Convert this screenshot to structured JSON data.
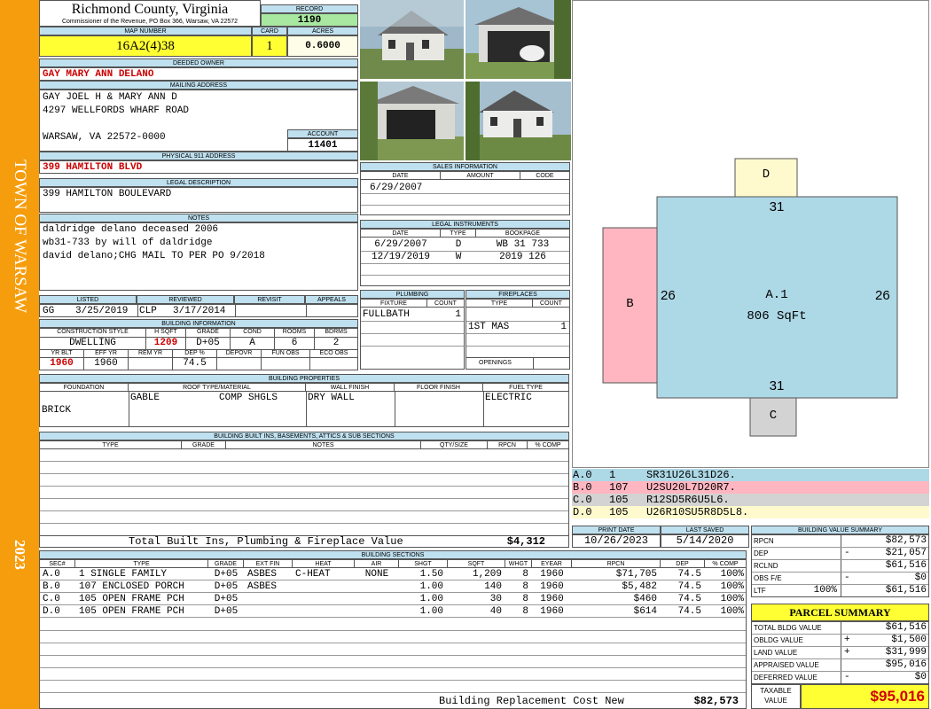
{
  "side": {
    "town": "TOWN OF WARSAW",
    "year": "2023"
  },
  "header": {
    "county": "Richmond County, Virginia",
    "commissioner": "Commissioner of the Revenue, PO Box 366, Warsaw, VA 22572",
    "record_label": "RECORD",
    "record": "1190",
    "map_label": "MAP NUMBER",
    "map": "16A2(4)38",
    "card_label": "CARD",
    "card": "1",
    "acres_label": "ACRES",
    "acres": "0.6000"
  },
  "owner": {
    "label": "DEEDED OWNER",
    "name": "GAY MARY ANN DELANO"
  },
  "mailing": {
    "label": "MAILING ADDRESS",
    "line1": "GAY JOEL H & MARY ANN D",
    "line2": "4297 WELLFORDS WHARF ROAD",
    "line3": "WARSAW, VA 22572-0000",
    "account_label": "ACCOUNT",
    "account": "11401"
  },
  "physical": {
    "label": "PHYSICAL 911 ADDRESS",
    "value": "399 HAMILTON BLVD"
  },
  "legal": {
    "label": "LEGAL DESCRIPTION",
    "value": "399 HAMILTON BOULEVARD"
  },
  "notes": {
    "label": "NOTES",
    "line1": "daldridge delano deceased 2006",
    "line2": "wb31-733 by will of daldridge",
    "line3": "david delano;CHG MAIL TO PER PO 9/2018"
  },
  "listed": {
    "listed_label": "LISTED",
    "listed_by": "GG",
    "listed_date": "3/25/2019",
    "reviewed_label": "REVIEWED",
    "reviewed_by": "CLP",
    "reviewed_date": "3/17/2014",
    "revisit_label": "REVISIT",
    "appeals_label": "APPEALS"
  },
  "building_info": {
    "label": "BUILDING INFORMATION",
    "h": [
      "CONSTRUCTION STYLE",
      "H SQFT",
      "GRADE",
      "COND",
      "ROOMS",
      "BDRMS"
    ],
    "v": [
      "DWELLING",
      "1209",
      "D+05",
      "A",
      "6",
      "2"
    ],
    "h2": [
      "YR BLT",
      "EFF YR",
      "REM YR",
      "DEP %",
      "DEPOVR",
      "FUN OBS",
      "ECO OBS"
    ],
    "v2": [
      "1960",
      "1960",
      "",
      "74.5",
      "",
      "",
      ""
    ]
  },
  "sales": {
    "label": "SALES INFORMATION",
    "h": [
      "DATE",
      "AMOUNT",
      "CODE"
    ],
    "rows": [
      [
        "6/29/2007",
        "",
        ""
      ]
    ]
  },
  "legal_inst": {
    "label": "LEGAL INSTRUMENTS",
    "h": [
      "DATE",
      "TYPE",
      "BOOKPAGE"
    ],
    "rows": [
      [
        "6/29/2007",
        "D",
        "WB 31 733"
      ],
      [
        "12/19/2019",
        "W",
        "2019 126"
      ]
    ]
  },
  "plumbing": {
    "label": "PLUMBING",
    "h": [
      "FIXTURE",
      "COUNT"
    ],
    "rows": [
      [
        "FULLBATH",
        "1"
      ]
    ]
  },
  "fireplaces": {
    "label": "FIREPLACES",
    "h": [
      "TYPE",
      "COUNT"
    ],
    "rows": [
      [
        "1ST MAS",
        "1"
      ]
    ],
    "openings": "OPENINGS"
  },
  "props": {
    "label": "BUILDING PROPERTIES",
    "h": [
      "FOUNDATION",
      "ROOF TYPE/MATERIAL",
      "WALL FINISH",
      "FLOOR FINISH",
      "FUEL TYPE"
    ],
    "foundation": "BRICK",
    "roof1": "GABLE",
    "roof2": "COMP SHGLS",
    "wall": "DRY WALL",
    "floor": "",
    "fuel": "ELECTRIC"
  },
  "builtins": {
    "label": "BUILDING BUILT INS, BASEMENTS, ATTICS & SUB SECTIONS",
    "h": [
      "TYPE",
      "GRADE",
      "NOTES",
      "QTY/SIZE",
      "RPCN",
      "% COMP"
    ],
    "total_label": "Total Built Ins, Plumbing & Fireplace Value",
    "total": "$4,312"
  },
  "sketch": {
    "main_label": "A.1",
    "main_area": "806 SqFt",
    "top": "31",
    "bottom": "31",
    "left": "26",
    "right": "26",
    "d": "D",
    "b": "B",
    "c": "C"
  },
  "sections_codes": [
    {
      "id": "A.0",
      "code": "1",
      "path": "SR31U26L31D26.",
      "color": "#add8e6"
    },
    {
      "id": "B.0",
      "code": "107",
      "path": "U2SU20L7D20R7.",
      "color": "#ffb6c1"
    },
    {
      "id": "C.0",
      "code": "105",
      "path": "R12SD5R6U5L6.",
      "color": "#d3d3d3"
    },
    {
      "id": "D.0",
      "code": "105",
      "path": "U26R10SU5R8D5L8.",
      "color": "#fffacd"
    }
  ],
  "dates": {
    "print_label": "PRINT DATE",
    "print": "10/26/2023",
    "saved_label": "LAST SAVED",
    "saved": "5/14/2020"
  },
  "bsections": {
    "label": "BUILDING SECTIONS",
    "h": [
      "SEC#",
      "TYPE",
      "GRADE",
      "EXT FIN",
      "HEAT",
      "AIR",
      "SHGT",
      "SQFT",
      "WHGT",
      "EYEAR",
      "RPCN",
      "DEP",
      "% COMP"
    ],
    "rows": [
      [
        "A.0",
        "1 SINGLE FAMILY",
        "D+05",
        "ASBES",
        "C-HEAT",
        "NONE",
        "1.50",
        "1,209",
        "8",
        "1960",
        "$71,705",
        "74.5",
        "100%"
      ],
      [
        "B.0",
        "107 ENCLOSED PORCH",
        "D+05",
        "ASBES",
        "",
        "",
        "1.00",
        "140",
        "8",
        "1960",
        "$5,482",
        "74.5",
        "100%"
      ],
      [
        "C.0",
        "105 OPEN FRAME PCH",
        "D+05",
        "",
        "",
        "",
        "1.00",
        "30",
        "8",
        "1960",
        "$460",
        "74.5",
        "100%"
      ],
      [
        "D.0",
        "105 OPEN FRAME PCH",
        "D+05",
        "",
        "",
        "",
        "1.00",
        "40",
        "8",
        "1960",
        "$614",
        "74.5",
        "100%"
      ]
    ],
    "total_label": "Building Replacement Cost New",
    "total": "$82,573"
  },
  "bvs": {
    "label": "BUILDING VALUE SUMMARY",
    "rows": [
      [
        "RPCN",
        "",
        "$82,573"
      ],
      [
        "DEP",
        "-",
        "$21,057"
      ],
      [
        "RCLND",
        "",
        "$61,516"
      ],
      [
        "OBS F/E",
        "-",
        "$0"
      ],
      [
        "LTF",
        "100%",
        "$61,516"
      ]
    ]
  },
  "parcel": {
    "label": "PARCEL SUMMARY",
    "rows": [
      [
        "TOTAL BLDG VALUE",
        "",
        "$61,516"
      ],
      [
        "OBLDG VALUE",
        "+",
        "$1,500"
      ],
      [
        "LAND VALUE",
        "+",
        "$31,999"
      ],
      [
        "APPRAISED VALUE",
        "",
        "$95,016"
      ],
      [
        "DEFERRED VALUE",
        "-",
        "$0"
      ]
    ],
    "taxable_label1": "TAXABLE",
    "taxable_label2": "VALUE",
    "taxable": "$95,016"
  },
  "photos": [
    "photo-house-front",
    "photo-carport",
    "photo-shed",
    "photo-house-side"
  ]
}
